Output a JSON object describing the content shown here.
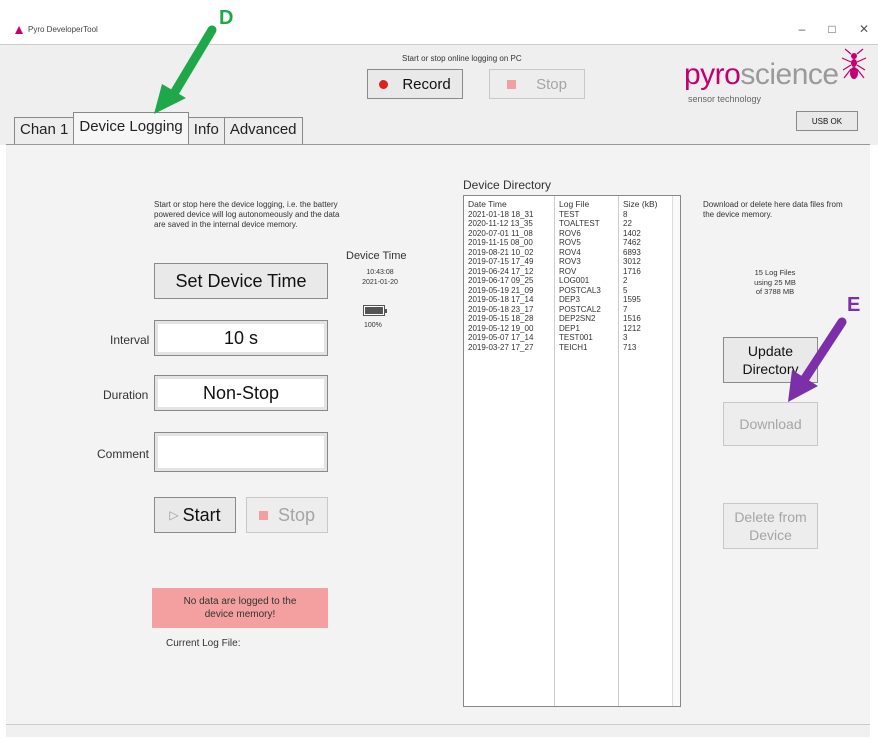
{
  "window": {
    "title": "Pyro DeveloperTool",
    "minimize": "–",
    "maximize": "□",
    "close": "✕"
  },
  "header": {
    "record_caption": "Start or stop online logging on PC",
    "record_label": "Record",
    "stop_label": "Stop",
    "logo_part1": "pyro",
    "logo_part2": "science",
    "logo_sub": "sensor technology",
    "usb_label": "USB OK"
  },
  "tabs": [
    {
      "label": "Chan 1"
    },
    {
      "label": "Device Logging"
    },
    {
      "label": "Info"
    },
    {
      "label": "Advanced"
    }
  ],
  "logging": {
    "description": "Start or stop here the device logging, i.e. the battery powered device will log autonomeously and the data are saved in the internal device memory.",
    "set_time_label": "Set Device Time",
    "device_time_label": "Device Time",
    "device_time_clock": "10:43:08",
    "device_time_date": "2021-01-20",
    "battery_level": 1.0,
    "battery_pct": "100%",
    "interval_label": "Interval",
    "interval_value": "10 s",
    "duration_label": "Duration",
    "duration_value": "Non-Stop",
    "comment_label": "Comment",
    "comment_value": "",
    "start_label": "Start",
    "stop_label": "Stop",
    "warning": "No data are logged to the device memory!",
    "current_log_label": "Current Log File:"
  },
  "directory": {
    "label": "Device Directory",
    "headers": [
      "Date Time",
      "Log File",
      "Size (kB)"
    ],
    "rows": [
      [
        "2021-01-18 18_31",
        "TEST",
        "8"
      ],
      [
        "2020-11-12 13_35",
        "TOALTEST",
        "22"
      ],
      [
        "2020-07-01 11_08",
        "ROV6",
        "1402"
      ],
      [
        "2019-11-15 08_00",
        "ROV5",
        "7462"
      ],
      [
        "2019-08-21 10_02",
        "ROV4",
        "6893"
      ],
      [
        "2019-07-15 17_49",
        "ROV3",
        "3012"
      ],
      [
        "2019-06-24 17_12",
        "ROV",
        "1716"
      ],
      [
        "2019-06-17 09_25",
        "LOG001",
        "2"
      ],
      [
        "2019-05-19 21_09",
        "POSTCAL3",
        "5"
      ],
      [
        "2019-05-18 17_14",
        "DEP3",
        "1595"
      ],
      [
        "2019-05-18 23_17",
        "POSTCAL2",
        "7"
      ],
      [
        "2019-05-15 18_28",
        "DEP2SN2",
        "1516"
      ],
      [
        "2019-05-12 19_00",
        "DEP1",
        "1212"
      ],
      [
        "2019-05-07 17_14",
        "TEST001",
        "3"
      ],
      [
        "2019-03-27 17_27",
        "TEICH1",
        "713"
      ]
    ],
    "description": "Download or delete here data files from the device memory.",
    "files_count": "15 Log Files",
    "usage_line": "using 25 MB",
    "capacity_line": "of 3788 MB",
    "update_label": "Update Directory",
    "download_label": "Download",
    "delete_label": "Delete from Device"
  },
  "annotations": {
    "d_label": "D",
    "e_label": "E",
    "d_color": "#1fa84a",
    "e_color": "#7b2fa8"
  }
}
